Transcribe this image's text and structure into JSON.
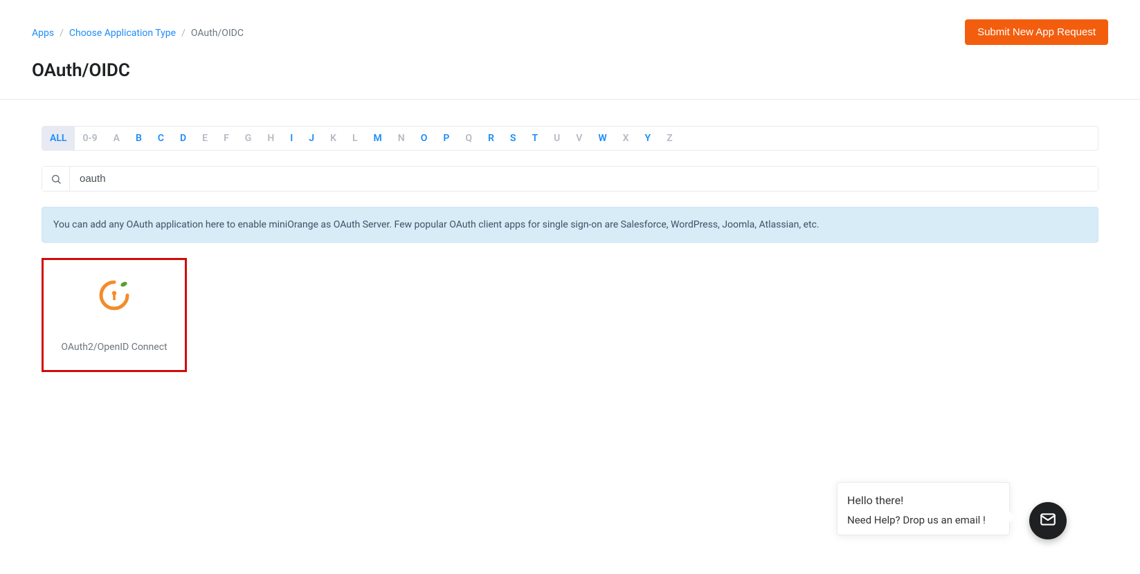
{
  "header": {
    "breadcrumb": {
      "apps": "Apps",
      "choose_type": "Choose Application Type",
      "current": "OAuth/OIDC"
    },
    "submit_button": "Submit New App Request",
    "page_title": "OAuth/OIDC"
  },
  "filter": {
    "items": [
      {
        "label": "ALL",
        "enabled": true,
        "active": true
      },
      {
        "label": "0-9",
        "enabled": false
      },
      {
        "label": "A",
        "enabled": false
      },
      {
        "label": "B",
        "enabled": true
      },
      {
        "label": "C",
        "enabled": true
      },
      {
        "label": "D",
        "enabled": true
      },
      {
        "label": "E",
        "enabled": false
      },
      {
        "label": "F",
        "enabled": false
      },
      {
        "label": "G",
        "enabled": false
      },
      {
        "label": "H",
        "enabled": false
      },
      {
        "label": "I",
        "enabled": true
      },
      {
        "label": "J",
        "enabled": true
      },
      {
        "label": "K",
        "enabled": false
      },
      {
        "label": "L",
        "enabled": false
      },
      {
        "label": "M",
        "enabled": true
      },
      {
        "label": "N",
        "enabled": false
      },
      {
        "label": "O",
        "enabled": true
      },
      {
        "label": "P",
        "enabled": true
      },
      {
        "label": "Q",
        "enabled": false
      },
      {
        "label": "R",
        "enabled": true
      },
      {
        "label": "S",
        "enabled": true
      },
      {
        "label": "T",
        "enabled": true
      },
      {
        "label": "U",
        "enabled": false
      },
      {
        "label": "V",
        "enabled": false
      },
      {
        "label": "W",
        "enabled": true
      },
      {
        "label": "X",
        "enabled": false
      },
      {
        "label": "Y",
        "enabled": true
      },
      {
        "label": "Z",
        "enabled": false
      }
    ]
  },
  "search": {
    "value": "oauth"
  },
  "info": {
    "text": "You can add any OAuth application here to enable miniOrange as OAuth Server. Few popular OAuth client apps for single sign-on are Salesforce, WordPress, Joomla, Atlassian, etc."
  },
  "app_card": {
    "label": "OAuth2/OpenID Connect"
  },
  "chat": {
    "line1": "Hello there!",
    "line2": "Need Help? Drop us an email !"
  }
}
